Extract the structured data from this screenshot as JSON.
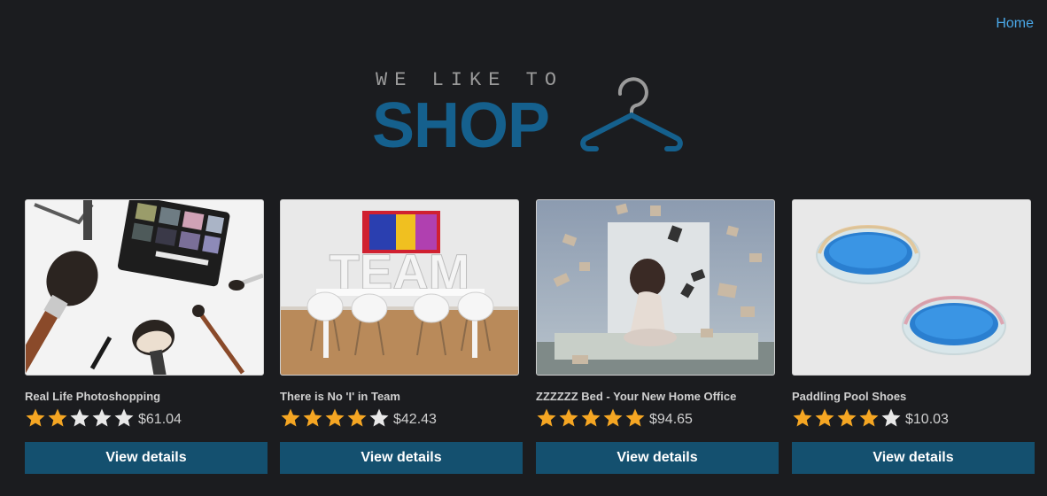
{
  "nav": {
    "home_label": "Home"
  },
  "logo": {
    "tagline": "WE LIKE TO",
    "word": "SHOP"
  },
  "colors": {
    "accent": "#15608d",
    "link": "#4aa8e8",
    "button": "#14506f",
    "star_filled": "#f5a623",
    "star_empty": "#e8e8e8"
  },
  "products": [
    {
      "title": "Real Life Photoshopping",
      "rating": 2,
      "max_rating": 5,
      "price": "$61.04",
      "button_label": "View details",
      "image": "makeup-brushes-photo"
    },
    {
      "title": "There is No 'I' in Team",
      "rating": 4,
      "max_rating": 5,
      "price": "$42.43",
      "button_label": "View details",
      "image": "team-table-photo"
    },
    {
      "title": "ZZZZZZ Bed - Your New Home Office",
      "rating": 5,
      "max_rating": 5,
      "price": "$94.65",
      "button_label": "View details",
      "image": "bed-flying-books-photo"
    },
    {
      "title": "Paddling Pool Shoes",
      "rating": 4,
      "max_rating": 5,
      "price": "$10.03",
      "button_label": "View details",
      "image": "paddling-pools-photo"
    }
  ]
}
